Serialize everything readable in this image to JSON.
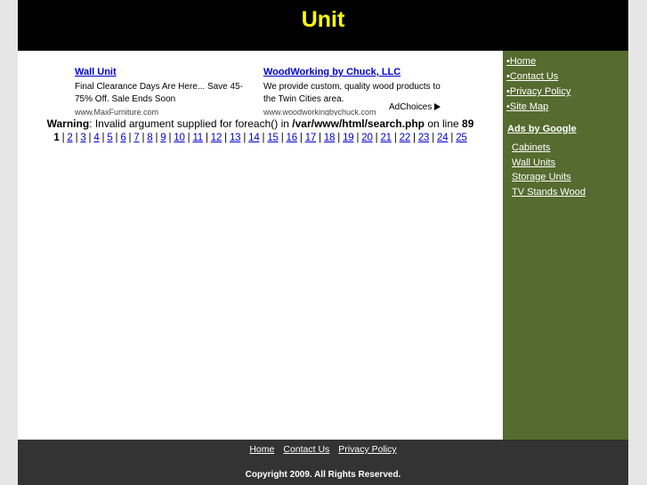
{
  "header": {
    "title": "Unit"
  },
  "ads": [
    {
      "title": "Wall Unit",
      "desc": "Final Clearance Days Are Here... Save 45-75% Off. Sale Ends Soon",
      "url": "www.MaxFurniture.com"
    },
    {
      "title": "WoodWorking by Chuck, LLC",
      "desc": "We provide custom, quality wood products to the Twin Cities area.",
      "url": "www.woodworkingbychuck.com"
    }
  ],
  "adchoices": "AdChoices",
  "warning": {
    "label": "Warning",
    "text": ": Invalid argument supplied for foreach() in ",
    "path": "/var/www/html/search.php",
    "mid": " on line ",
    "line": "89"
  },
  "pagination": {
    "current": "1",
    "pages": [
      "2",
      "3",
      "4",
      "5",
      "6",
      "7",
      "8",
      "9",
      "10",
      "11",
      "12",
      "13",
      "14",
      "15",
      "16",
      "17",
      "18",
      "19",
      "20",
      "21",
      "22",
      "23",
      "24",
      "25"
    ]
  },
  "sidebar": {
    "links": [
      "Home",
      "Contact Us",
      "Privacy Policy",
      "Site Map"
    ],
    "bullet": "•",
    "ads_heading": "Ads by Google",
    "ads_links": [
      "Cabinets",
      "Wall Units",
      "Storage Units",
      "TV Stands Wood"
    ]
  },
  "footer": {
    "links": [
      "Home",
      "Contact Us",
      "Privacy Policy"
    ],
    "copyright": "Copyright 2009. All Rights Reserved."
  },
  "colors": {
    "header_bg": "#000000",
    "title": "#ffff00",
    "sidebar_bg": "#556b2f",
    "footer_bg": "#333333",
    "link": "#0000cc"
  }
}
